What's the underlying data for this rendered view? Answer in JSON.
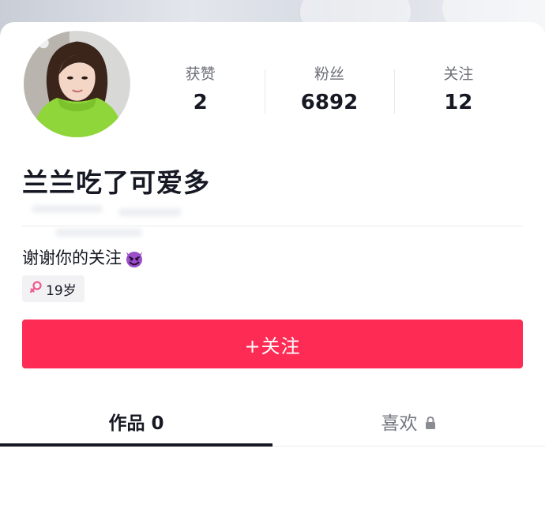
{
  "profile": {
    "nickname": "兰兰吃了可爱多",
    "bio": "谢谢你的关注",
    "bio_emoji_icon": "devil-smile-icon",
    "gender_icon": "female-icon",
    "age_tag": "19岁"
  },
  "stats": [
    {
      "label": "获赞",
      "value": "2"
    },
    {
      "label": "粉丝",
      "value": "6892"
    },
    {
      "label": "关注",
      "value": "12"
    }
  ],
  "follow_button": {
    "label": "+关注"
  },
  "tabs": [
    {
      "label": "作品 0",
      "active": true
    },
    {
      "label": "喜欢",
      "active": false,
      "icon": "lock-icon"
    }
  ],
  "colors": {
    "accent": "#fe2c55",
    "text_primary": "#161823",
    "text_secondary": "#6b6e76",
    "tag_background": "#f2f2f4",
    "gender_female": "#f05a8c"
  }
}
